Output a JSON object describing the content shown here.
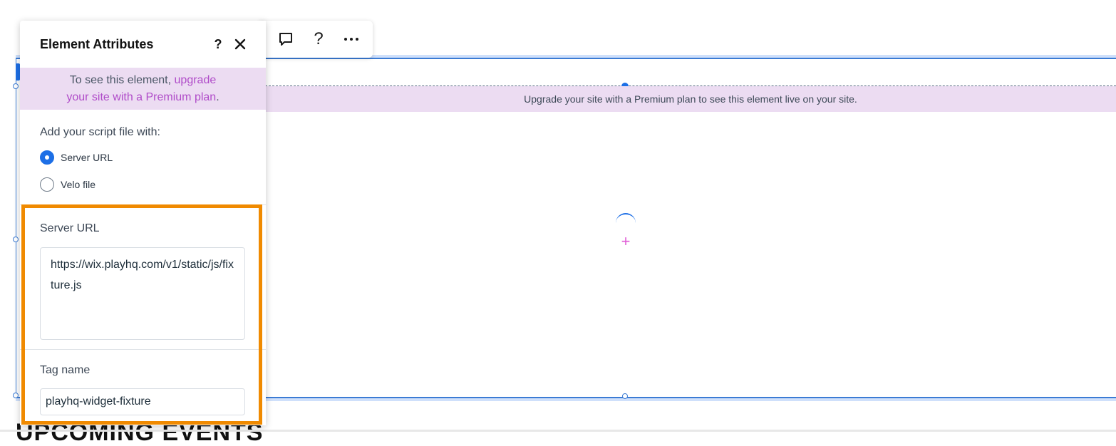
{
  "panel": {
    "title": "Element Attributes",
    "help_label": "?",
    "banner": {
      "line1_text": "To see this element, ",
      "line1_link": "upgrade",
      "line2_link": "your site with a Premium plan",
      "line2_end": "."
    },
    "script_source": {
      "label": "Add your script file with:",
      "options": [
        {
          "label": "Server URL",
          "selected": true
        },
        {
          "label": "Velo file",
          "selected": false
        }
      ]
    },
    "server_url": {
      "label": "Server URL",
      "value": "https://wix.playhq.com/v1/static/js/fixture.js"
    },
    "tag_name": {
      "label": "Tag name",
      "value": "playhq-widget-fixture"
    }
  },
  "toolbar": {
    "items": [
      {
        "icon": "comment-icon"
      },
      {
        "icon": "help-icon",
        "label": "?"
      },
      {
        "icon": "more-icon",
        "label": "···"
      }
    ]
  },
  "canvas": {
    "premium_notice": "Upgrade your site with a Premium plan to see this element live on your site.",
    "heading": "UPCOMING EVENTS"
  },
  "colors": {
    "accent": "#1d6fe6",
    "premium_bg": "#ecdcf2",
    "premium_link": "#b04cc9",
    "highlight": "#f08a00"
  }
}
